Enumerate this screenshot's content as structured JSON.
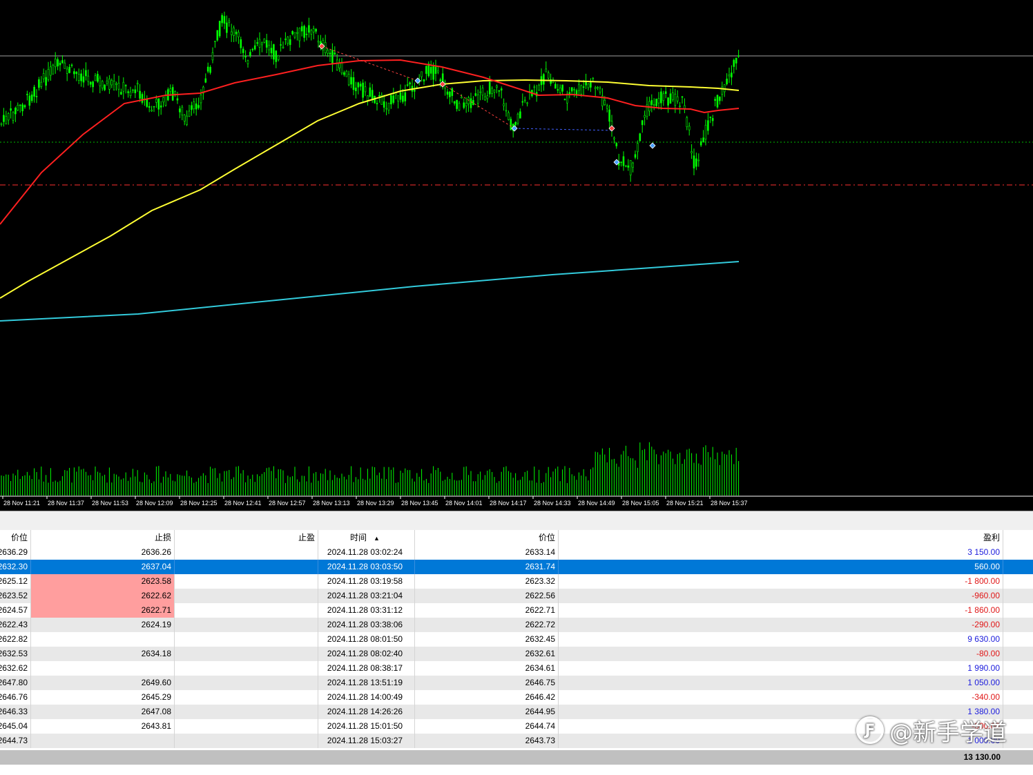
{
  "chart": {
    "time_labels": [
      "28 Nov 11:21",
      "28 Nov 11:37",
      "28 Nov 11:53",
      "28 Nov 12:09",
      "28 Nov 12:25",
      "28 Nov 12:41",
      "28 Nov 12:57",
      "28 Nov 13:13",
      "28 Nov 13:29",
      "28 Nov 13:45",
      "28 Nov 14:01",
      "28 Nov 14:17",
      "28 Nov 14:33",
      "28 Nov 14:49",
      "28 Nov 15:05",
      "28 Nov 15:21",
      "28 Nov 15:37"
    ],
    "colors": {
      "background": "#000000",
      "candles": "#00ff00",
      "ma_fast": "#ff2020",
      "ma_slow": "#ffff33",
      "ma_long": "#33ccdd",
      "volume": "#00ff00",
      "stop_line": "#ff3030",
      "grid_dotted": "#00c000",
      "price_line": "#a0a0a0"
    }
  },
  "table": {
    "headers": {
      "price_open": "价位",
      "sl": "止损",
      "tp": "止盈",
      "time": "时间",
      "price_close": "价位",
      "profit": "盈利"
    },
    "rows": [
      {
        "price": "2636.29",
        "sl": "2636.26",
        "tp": "",
        "time": "2024.11.28 03:02:24",
        "close": "2633.14",
        "profit": "3 150.00",
        "sign": "pos",
        "sl_hit": false
      },
      {
        "price": "2632.30",
        "sl": "2637.04",
        "tp": "",
        "time": "2024.11.28 03:03:50",
        "close": "2631.74",
        "profit": "560.00",
        "sign": "pos",
        "sl_hit": false
      },
      {
        "price": "2625.12",
        "sl": "2623.58",
        "tp": "",
        "time": "2024.11.28 03:19:58",
        "close": "2623.32",
        "profit": "-1 800.00",
        "sign": "neg",
        "sl_hit": true
      },
      {
        "price": "2623.52",
        "sl": "2622.62",
        "tp": "",
        "time": "2024.11.28 03:21:04",
        "close": "2622.56",
        "profit": "-960.00",
        "sign": "neg",
        "sl_hit": true
      },
      {
        "price": "2624.57",
        "sl": "2622.71",
        "tp": "",
        "time": "2024.11.28 03:31:12",
        "close": "2622.71",
        "profit": "-1 860.00",
        "sign": "neg",
        "sl_hit": true
      },
      {
        "price": "2622.43",
        "sl": "2624.19",
        "tp": "",
        "time": "2024.11.28 03:38:06",
        "close": "2622.72",
        "profit": "-290.00",
        "sign": "neg",
        "sl_hit": false
      },
      {
        "price": "2622.82",
        "sl": "",
        "tp": "",
        "time": "2024.11.28 08:01:50",
        "close": "2632.45",
        "profit": "9 630.00",
        "sign": "pos",
        "sl_hit": false
      },
      {
        "price": "2632.53",
        "sl": "2634.18",
        "tp": "",
        "time": "2024.11.28 08:02:40",
        "close": "2632.61",
        "profit": "-80.00",
        "sign": "neg",
        "sl_hit": false
      },
      {
        "price": "2632.62",
        "sl": "",
        "tp": "",
        "time": "2024.11.28 08:38:17",
        "close": "2634.61",
        "profit": "1 990.00",
        "sign": "pos",
        "sl_hit": false
      },
      {
        "price": "2647.80",
        "sl": "2649.60",
        "tp": "",
        "time": "2024.11.28 13:51:19",
        "close": "2646.75",
        "profit": "1 050.00",
        "sign": "pos",
        "sl_hit": false
      },
      {
        "price": "2646.76",
        "sl": "2645.29",
        "tp": "",
        "time": "2024.11.28 14:00:49",
        "close": "2646.42",
        "profit": "-340.00",
        "sign": "neg",
        "sl_hit": false
      },
      {
        "price": "2646.33",
        "sl": "2647.08",
        "tp": "",
        "time": "2024.11.28 14:26:26",
        "close": "2644.95",
        "profit": "1 380.00",
        "sign": "pos",
        "sl_hit": false
      },
      {
        "price": "2645.04",
        "sl": "2643.81",
        "tp": "",
        "time": "2024.11.28 15:01:50",
        "close": "2644.74",
        "profit": "-300.00",
        "sign": "neg",
        "sl_hit": false
      },
      {
        "price": "2644.73",
        "sl": "",
        "tp": "",
        "time": "2024.11.28 15:03:27",
        "close": "2643.73",
        "profit": "1 000.00",
        "sign": "pos",
        "sl_hit": false
      }
    ],
    "selected_row": 1,
    "total": "13 130.00"
  },
  "watermark": {
    "text": "@新手学道",
    "icon": "zhihu-logo-icon"
  }
}
